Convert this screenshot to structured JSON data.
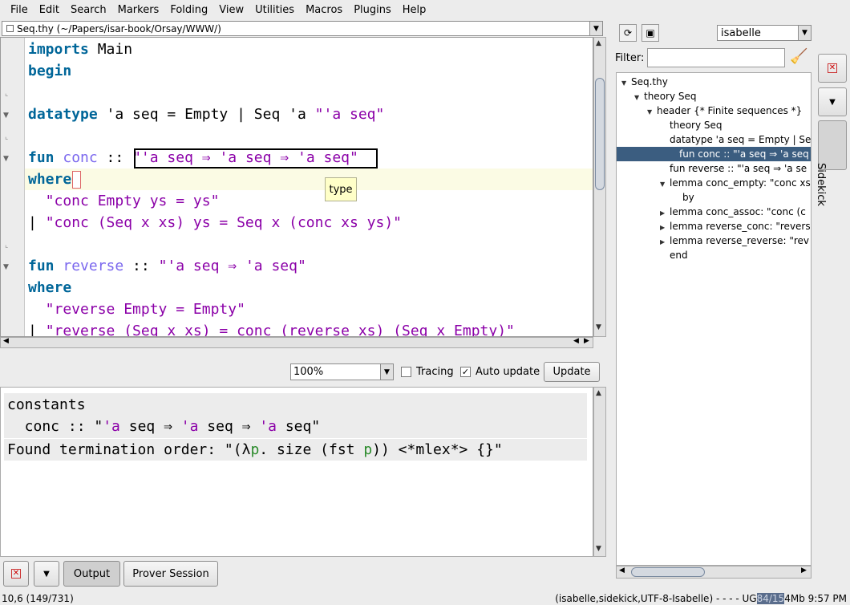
{
  "menu": [
    "File",
    "Edit",
    "Search",
    "Markers",
    "Folding",
    "View",
    "Utilities",
    "Macros",
    "Plugins",
    "Help"
  ],
  "buffer_title": "Seq.thy (~/Papers/isar-book/Orsay/WWW/)",
  "editor": {
    "lines": [
      {
        "t": "imports Main"
      },
      {
        "t": "begin"
      },
      {
        "t": ""
      },
      {
        "t": "datatype 'a seq = Empty | Seq 'a \"'a seq\""
      },
      {
        "t": ""
      },
      {
        "t": "fun conc :: \"'a seq ⇒ 'a seq ⇒ 'a seq\""
      },
      {
        "t": "where"
      },
      {
        "t": "  \"conc Empty ys = ys\""
      },
      {
        "t": "| \"conc (Seq x xs) ys = Seq x (conc xs ys)\""
      },
      {
        "t": ""
      },
      {
        "t": "fun reverse :: \"'a seq ⇒ 'a seq\""
      },
      {
        "t": "where"
      },
      {
        "t": "  \"reverse Empty = Empty\""
      },
      {
        "t": "| \"reverse (Seq x xs) = conc (reverse xs) (Seq x Empty)\""
      }
    ],
    "tooltip": "type"
  },
  "output_toolbar": {
    "zoom": "100%",
    "tracing_label": "Tracing",
    "tracing_checked": false,
    "auto_update_label": "Auto update",
    "auto_update_checked": true,
    "update_label": "Update"
  },
  "output": {
    "line1": "constants",
    "line2": "  conc :: \"'a seq ⇒ 'a seq ⇒ 'a seq\"",
    "line3": "Found termination order: \"(λp. size (fst p)) <*mlex*> {}\""
  },
  "dock": {
    "output_label": "Output",
    "prover_label": "Prover Session"
  },
  "status": {
    "left": "10,6 (149/731)",
    "right_prefix": "(isabelle,sidekick,UTF-8-Isabelle) - - - - UG",
    "mem_used": "84/15",
    "mem_rest": "4Mb",
    "time": "9:57 PM"
  },
  "sidekick": {
    "parser": "isabelle",
    "filter_label": "Filter:",
    "filter_value": "",
    "tab_label": "Sidekick",
    "tree": [
      {
        "label": "Seq.thy",
        "tri": "▼",
        "level": 0
      },
      {
        "label": "theory Seq",
        "tri": "▼",
        "level": 1
      },
      {
        "label": "header {* Finite sequences *}",
        "tri": "▼",
        "level": 2
      },
      {
        "label": "theory Seq",
        "tri": "",
        "level": 3
      },
      {
        "label": "datatype 'a seq = Empty | Se",
        "tri": "",
        "level": 3
      },
      {
        "label": "fun conc :: \"'a seq ⇒ 'a seq ⇒",
        "tri": "",
        "level": 3,
        "selected": true
      },
      {
        "label": "fun reverse :: \"'a seq ⇒ 'a se",
        "tri": "",
        "level": 3
      },
      {
        "label": "lemma conc_empty: \"conc xs",
        "tri": "▼",
        "level": 3
      },
      {
        "label": "by",
        "tri": "",
        "level": 4
      },
      {
        "label": "lemma conc_assoc: \"conc (c",
        "tri": "▶",
        "level": 3
      },
      {
        "label": "lemma reverse_conc: \"revers",
        "tri": "▶",
        "level": 3
      },
      {
        "label": "lemma reverse_reverse: \"rev",
        "tri": "▶",
        "level": 3
      },
      {
        "label": "end",
        "tri": "",
        "level": 3
      }
    ]
  },
  "colors": {
    "keyword": "#006699",
    "constant": "#7b68ee",
    "free_var": "#8b00a8",
    "selection": "#3b5d80",
    "caret_line": "#fbfbe4",
    "tooltip_bg": "#ffffc8"
  },
  "icons": [
    "checkbox-icon",
    "dropdown-arrow-icon",
    "fold-triangle-icon",
    "close-icon",
    "broom-icon",
    "reparse-icon",
    "expand-icon"
  ]
}
